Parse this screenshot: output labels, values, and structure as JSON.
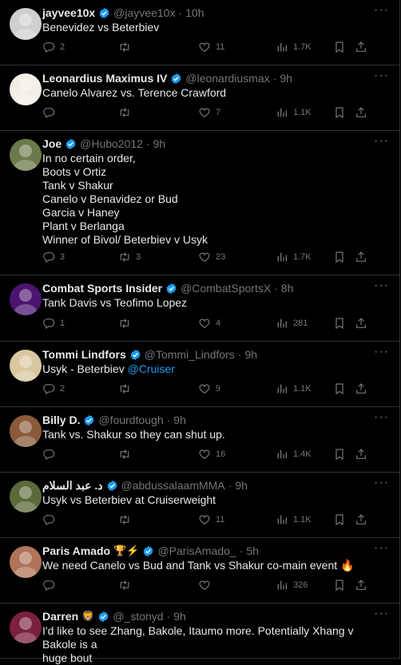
{
  "tweets": [
    {
      "name": "jayvee10x",
      "handle": "@jayvee10x",
      "time": "10h",
      "emoji": "",
      "lines": [
        "Benevidez vs Beterbiev"
      ],
      "replies": "2",
      "retweets": "",
      "likes": "11",
      "views": "1.7K",
      "avatar_color": "#cfcfcf"
    },
    {
      "name": "Leonardius Maximus IV",
      "handle": "@leonardiusmax",
      "time": "9h",
      "emoji": "",
      "lines": [
        "Canelo Alvarez vs. Terence Crawford"
      ],
      "replies": "",
      "retweets": "",
      "likes": "7",
      "views": "1.1K",
      "avatar_color": "#f2efe6"
    },
    {
      "name": "Joe",
      "handle": "@Hubo2012",
      "time": "9h",
      "emoji": "",
      "lines": [
        "In no certain order,",
        "Boots v Ortiz",
        "Tank v Shakur",
        "Canelo v Benavidez or Bud",
        "Garcia v Haney",
        "Plant v Berlanga",
        "Winner of Bivol/ Beterbiev v Usyk"
      ],
      "replies": "3",
      "retweets": "3",
      "likes": "23",
      "views": "1.7K",
      "avatar_color": "#6b7a4a"
    },
    {
      "name": "Combat Sports Insider",
      "handle": "@CombatSportsX",
      "time": "8h",
      "emoji": "",
      "lines": [
        "Tank Davis vs Teofimo Lopez"
      ],
      "replies": "1",
      "retweets": "",
      "likes": "4",
      "views": "281",
      "avatar_color": "#4a1470"
    },
    {
      "name": "Tommi Lindfors",
      "handle": "@Tommi_Lindfors",
      "time": "9h",
      "emoji": "",
      "lines": [
        "Usyk - Beterbiev"
      ],
      "link": "@Cruiser",
      "replies": "2",
      "retweets": "",
      "likes": "9",
      "views": "1.1K",
      "avatar_color": "#d9c7a0"
    },
    {
      "name": "Billy D.",
      "handle": "@fourdtough",
      "time": "9h",
      "emoji": "",
      "lines": [
        "Tank vs. Shakur so they can shut up."
      ],
      "replies": "",
      "retweets": "",
      "likes": "16",
      "views": "1.4K",
      "avatar_color": "#8a5a3a"
    },
    {
      "name": "د. عبد السلام",
      "handle": "@abdussalaamMMA",
      "time": "9h",
      "emoji": "",
      "lines": [
        "Usyk vs Beterbiev at Cruiserweight"
      ],
      "replies": "",
      "retweets": "",
      "likes": "11",
      "views": "1.1K",
      "avatar_color": "#5a6a3a"
    },
    {
      "name": "Paris Amado",
      "handle": "@ParisAmado_",
      "time": "5h",
      "emoji": "🏆⚡",
      "lines": [
        "We need Canelo vs Bud and Tank vs Shakur co-main event 🔥"
      ],
      "replies": "",
      "retweets": "",
      "likes": "",
      "views": "326",
      "avatar_color": "#b0745a"
    },
    {
      "name": "Darren",
      "handle": "@_stonyd",
      "time": "9h",
      "emoji": "🦁",
      "lines": [
        "I'd like to see Zhang, Bakole, Itaumo more. Potentially Xhang v Bakole is a",
        "huge bout"
      ],
      "replies": "",
      "retweets": "",
      "likes": "",
      "views": "",
      "avatar_color": "#7a2040"
    }
  ],
  "icons": {
    "reply": "reply-icon",
    "retweet": "retweet-icon",
    "like": "heart-icon",
    "views": "views-icon",
    "bookmark": "bookmark-icon",
    "share": "share-icon",
    "verified": "verified-badge-icon",
    "more": "more-icon"
  },
  "colors": {
    "background": "#000000",
    "text": "#e7e9ea",
    "muted": "#71767b",
    "accent": "#1d9bf0",
    "border": "#2f3336"
  }
}
